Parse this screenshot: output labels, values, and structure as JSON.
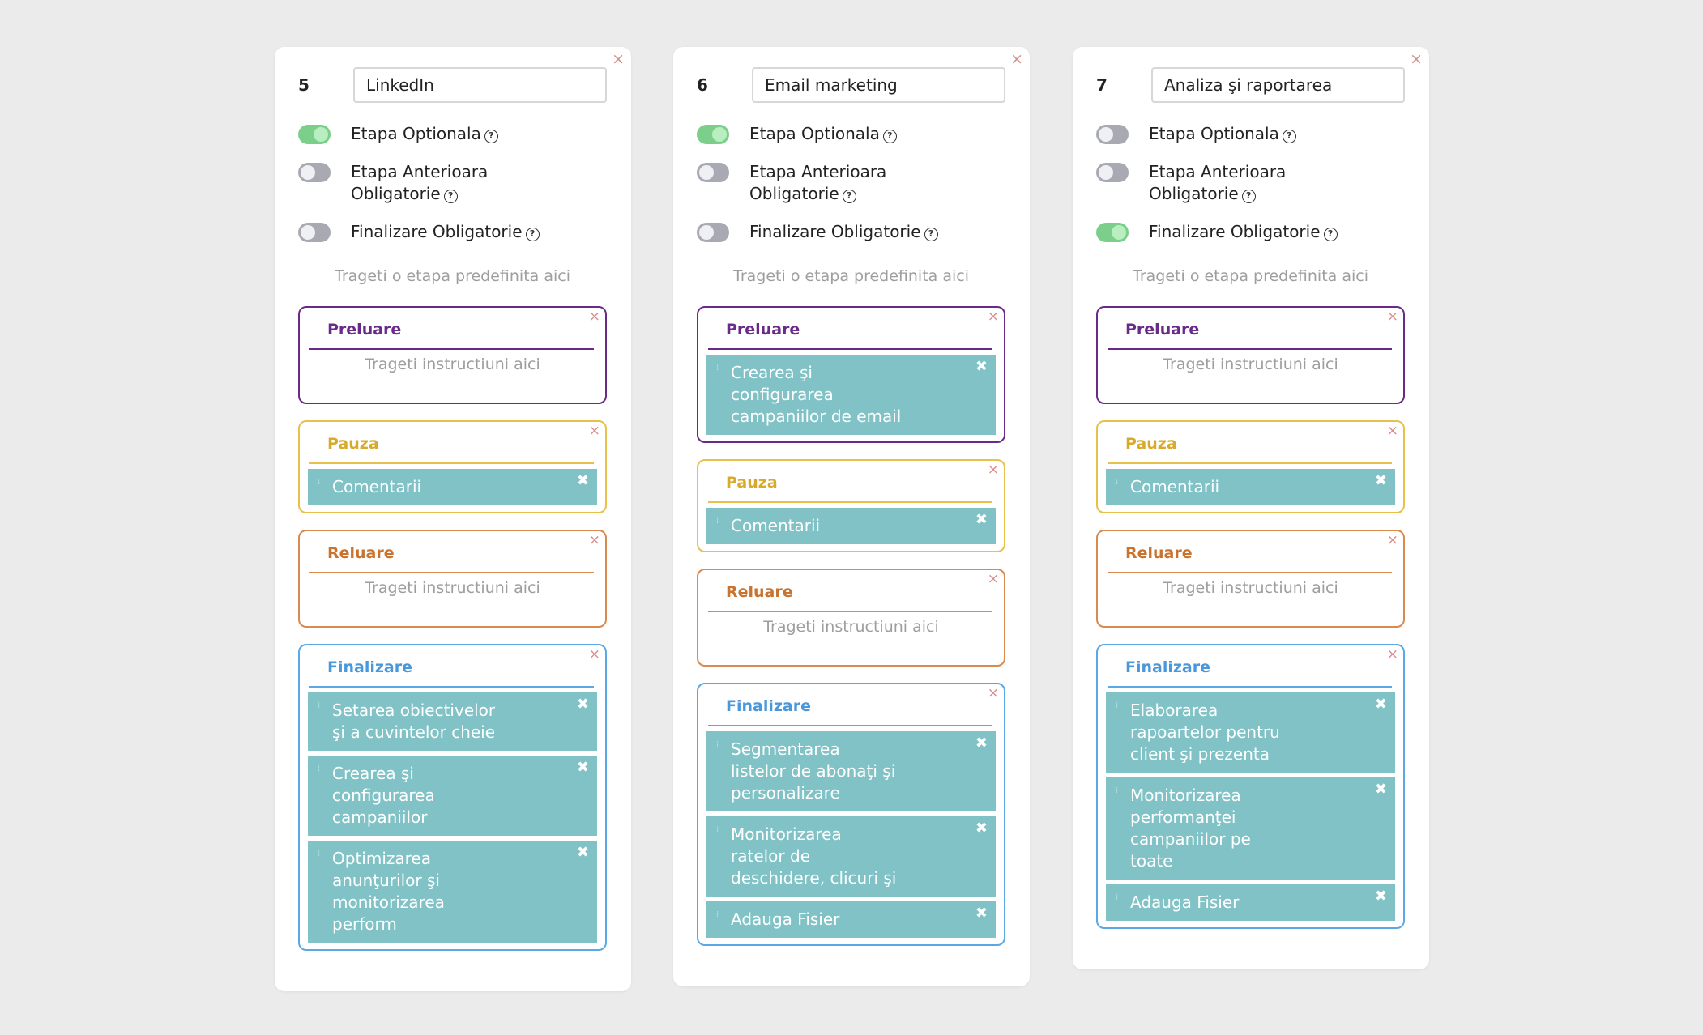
{
  "help_symbol": "?",
  "close_symbol": "×",
  "item_close_symbol": "✖",
  "grip_symbol": "⁞",
  "cards": [
    {
      "number": "5",
      "name": "LinkedIn",
      "toggles": [
        {
          "label": "Etapa Optionala",
          "on": true
        },
        {
          "label": "Etapa Anterioara Obligatorie",
          "on": false
        },
        {
          "label": "Finalizare Obligatorie",
          "on": false
        }
      ],
      "drop_hint": "Trageti o etapa predefinita aici",
      "sections": [
        {
          "kind": "preluare",
          "title": "Preluare",
          "empty_text": "Trageti instructiuni aici",
          "items": []
        },
        {
          "kind": "pauza",
          "title": "Pauza",
          "empty_text": "",
          "items": [
            "Comentarii"
          ]
        },
        {
          "kind": "reluare",
          "title": "Reluare",
          "empty_text": "Trageti instructiuni aici",
          "items": []
        },
        {
          "kind": "finalizare",
          "title": "Finalizare",
          "empty_text": "",
          "items": [
            "Setarea obiectivelor şi a cuvintelor cheie",
            "Crearea şi configurarea campaniilor",
            "Optimizarea anunţurilor şi monitorizarea perform"
          ]
        }
      ]
    },
    {
      "number": "6",
      "name": "Email marketing",
      "toggles": [
        {
          "label": "Etapa Optionala",
          "on": true
        },
        {
          "label": "Etapa Anterioara Obligatorie",
          "on": false
        },
        {
          "label": "Finalizare Obligatorie",
          "on": false
        }
      ],
      "drop_hint": "Trageti o etapa predefinita aici",
      "sections": [
        {
          "kind": "preluare",
          "title": "Preluare",
          "empty_text": "",
          "items": [
            "Crearea şi configurarea campaniilor de email"
          ]
        },
        {
          "kind": "pauza",
          "title": "Pauza",
          "empty_text": "",
          "items": [
            "Comentarii"
          ]
        },
        {
          "kind": "reluare",
          "title": "Reluare",
          "empty_text": "Trageti instructiuni aici",
          "items": []
        },
        {
          "kind": "finalizare",
          "title": "Finalizare",
          "empty_text": "",
          "items": [
            "Segmentarea listelor de abonaţi şi personalizare",
            "Monitorizarea ratelor de deschidere, clicuri şi",
            "Adauga Fisier"
          ]
        }
      ]
    },
    {
      "number": "7",
      "name": "Analiza şi raportarea",
      "toggles": [
        {
          "label": "Etapa Optionala",
          "on": false
        },
        {
          "label": "Etapa Anterioara Obligatorie",
          "on": false
        },
        {
          "label": "Finalizare Obligatorie",
          "on": true
        }
      ],
      "drop_hint": "Trageti o etapa predefinita aici",
      "sections": [
        {
          "kind": "preluare",
          "title": "Preluare",
          "empty_text": "Trageti instructiuni aici",
          "items": []
        },
        {
          "kind": "pauza",
          "title": "Pauza",
          "empty_text": "",
          "items": [
            "Comentarii"
          ]
        },
        {
          "kind": "reluare",
          "title": "Reluare",
          "empty_text": "Trageti instructiuni aici",
          "items": []
        },
        {
          "kind": "finalizare",
          "title": "Finalizare",
          "empty_text": "",
          "items": [
            "Elaborarea rapoartelor pentru client şi prezenta",
            "Monitorizarea performanţei campaniilor pe toate",
            "Adauga Fisier"
          ]
        }
      ]
    }
  ]
}
